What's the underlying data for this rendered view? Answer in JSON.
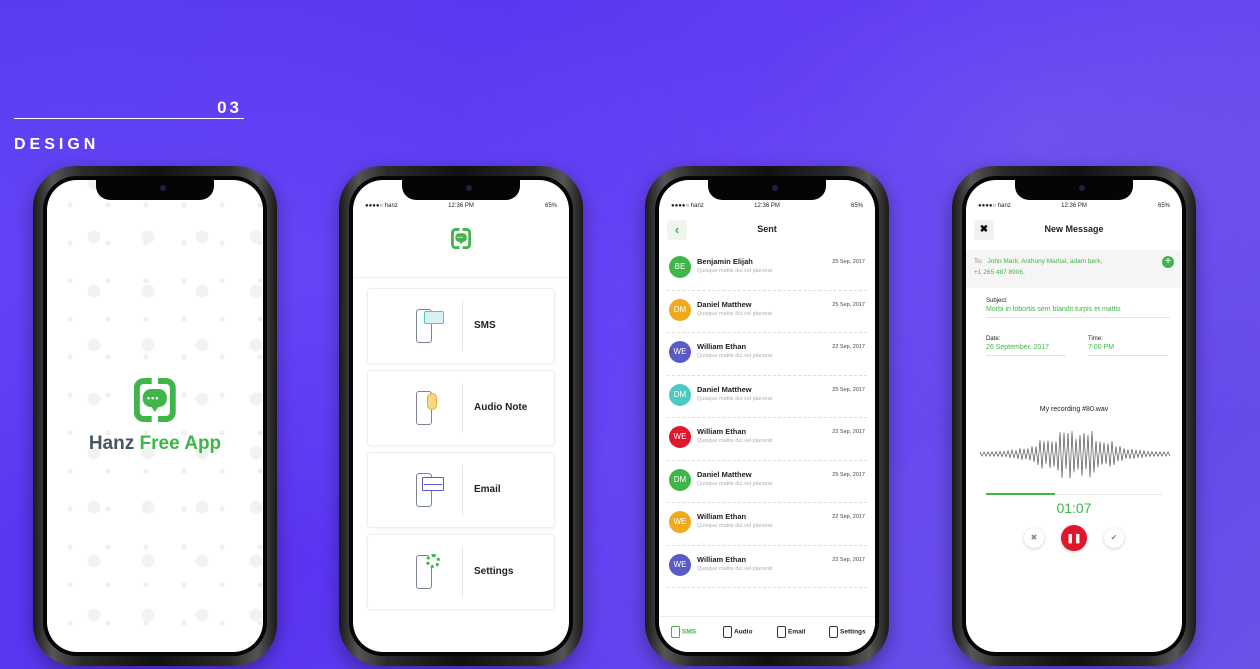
{
  "section": {
    "number": "03",
    "title": "DESIGN"
  },
  "colors": {
    "accent": "#3fb54a",
    "background": "#5a34f2",
    "pause": "#e0172c"
  },
  "status_bar": {
    "carrier": "●●●●○ hanz",
    "time": "12:36 PM",
    "battery": "65%"
  },
  "splash": {
    "brand_a": "Hanz ",
    "brand_b": "Free App"
  },
  "menu": {
    "items": [
      {
        "label": "SMS",
        "icon": "sms-icon"
      },
      {
        "label": "Audio Note",
        "icon": "microphone-icon"
      },
      {
        "label": "Email",
        "icon": "email-icon"
      },
      {
        "label": "Settings",
        "icon": "gear-icon"
      }
    ]
  },
  "sent": {
    "title": "Sent",
    "rows": [
      {
        "initials": "BE",
        "name": "Benjamin Elijah",
        "preview": "Quisque mattis dui vel placerat",
        "date": "25 Sep, 2017",
        "color": "#3fb54a"
      },
      {
        "initials": "DM",
        "name": "Daniel Matthew",
        "preview": "Quisque mattis dui vel placerat",
        "date": "25 Sep, 2017",
        "color": "#f0a81d"
      },
      {
        "initials": "WE",
        "name": "William Ethan",
        "preview": "Quisque mattis dui vel placerat",
        "date": "22 Sep, 2017",
        "color": "#5a5bc7"
      },
      {
        "initials": "DM",
        "name": "Daniel Matthew",
        "preview": "Quisque mattis dui vel placerat",
        "date": "25 Sep, 2017",
        "color": "#4cc9c0"
      },
      {
        "initials": "WE",
        "name": "William Ethan",
        "preview": "Quisque mattis dui vel placerat",
        "date": "22 Sep, 2017",
        "color": "#e0172c"
      },
      {
        "initials": "DM",
        "name": "Daniel Matthew",
        "preview": "Quisque mattis dui vel placerat",
        "date": "25 Sep, 2017",
        "color": "#3fb54a"
      },
      {
        "initials": "WE",
        "name": "William Ethan",
        "preview": "Quisque mattis dui vel placerat",
        "date": "22 Sep, 2017",
        "color": "#f0a81d"
      },
      {
        "initials": "WE",
        "name": "William Ethan",
        "preview": "Quisque mattis dui vel placerat",
        "date": "22 Sep, 2017",
        "color": "#5a5bc7"
      }
    ],
    "tabs": [
      {
        "label": "SMS",
        "active": true
      },
      {
        "label": "Audio",
        "active": false
      },
      {
        "label": "Email",
        "active": false
      },
      {
        "label": "Settings",
        "active": false
      }
    ]
  },
  "new_message": {
    "title": "New Message",
    "to_label": "To:",
    "recipients": "John Mark,   Anthony Martial,   adam berk,",
    "phone": "+1 265 487 8906,",
    "subject_label": "Subject:",
    "subject": "Morbi in lobortis sem blandit turpis et mattis",
    "date_label": "Date:",
    "date": "26 September, 2017",
    "time_label": "Time:",
    "time": "7:00 PM",
    "recording": "My recording #80.wav",
    "timer": "01:07",
    "recording_progress": 0.39
  }
}
